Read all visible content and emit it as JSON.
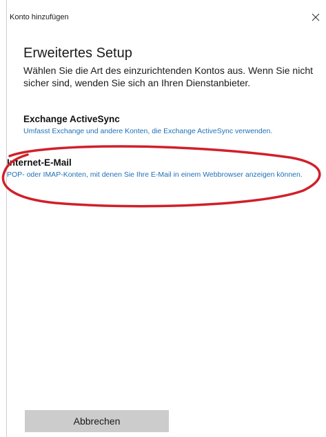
{
  "window": {
    "title": "Konto hinzufügen",
    "close_icon": "close-icon"
  },
  "setup": {
    "heading": "Erweitertes Setup",
    "description": "Wählen Sie die Art des einzurichtenden Kontos aus. Wenn Sie nicht sicher sind, wenden Sie sich an Ihren Dienstanbieter."
  },
  "options": [
    {
      "title": "Exchange ActiveSync",
      "description": "Umfasst Exchange und andere Konten, die Exchange ActiveSync verwenden."
    },
    {
      "title": "Internet-E-Mail",
      "description": "POP- oder IMAP-Konten, mit denen Sie Ihre E-Mail in einem Webbrowser anzeigen können."
    }
  ],
  "annotation": {
    "highlight_color": "#d0202a"
  },
  "actions": {
    "cancel_label": "Abbrechen"
  },
  "colors": {
    "link_blue": "#1f6fb5",
    "button_gray": "#cccccc"
  }
}
